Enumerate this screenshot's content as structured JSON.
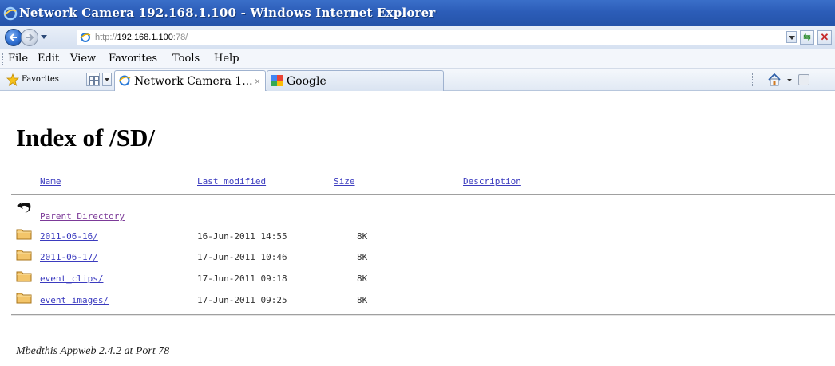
{
  "window": {
    "title": "Network Camera 192.168.1.100 - Windows Internet Explorer"
  },
  "address_bar": {
    "url_prefix": "http://",
    "url_host": "192.168.1.100",
    "url_suffix": ":78/"
  },
  "menu": {
    "items": [
      "File",
      "Edit",
      "View",
      "Favorites",
      "Tools",
      "Help"
    ]
  },
  "favorites_bar": {
    "favorites_label": "Favorites",
    "tabs": [
      {
        "title": "Network Camera 1...",
        "close": "×",
        "active": true
      },
      {
        "title": "Google",
        "active": false
      }
    ]
  },
  "page": {
    "title": "Index of /SD/",
    "columns": {
      "name": "Name",
      "last_modified": "Last modified",
      "size": "Size",
      "description": "Description"
    },
    "parent": {
      "label": "Parent Directory",
      "icon": "back-arrow-icon"
    },
    "rows": [
      {
        "name": "2011-06-16/",
        "modified": "16-Jun-2011 14:55",
        "size": "8K",
        "icon": "folder-icon"
      },
      {
        "name": "2011-06-17/",
        "modified": "17-Jun-2011 10:46",
        "size": "8K",
        "icon": "folder-icon"
      },
      {
        "name": "event_clips/",
        "modified": "17-Jun-2011 09:18",
        "size": "8K",
        "icon": "folder-icon"
      },
      {
        "name": "event_images/",
        "modified": "17-Jun-2011 09:25",
        "size": "8K",
        "icon": "folder-icon"
      }
    ],
    "footer": "Mbedthis Appweb 2.4.2 at Port 78"
  }
}
